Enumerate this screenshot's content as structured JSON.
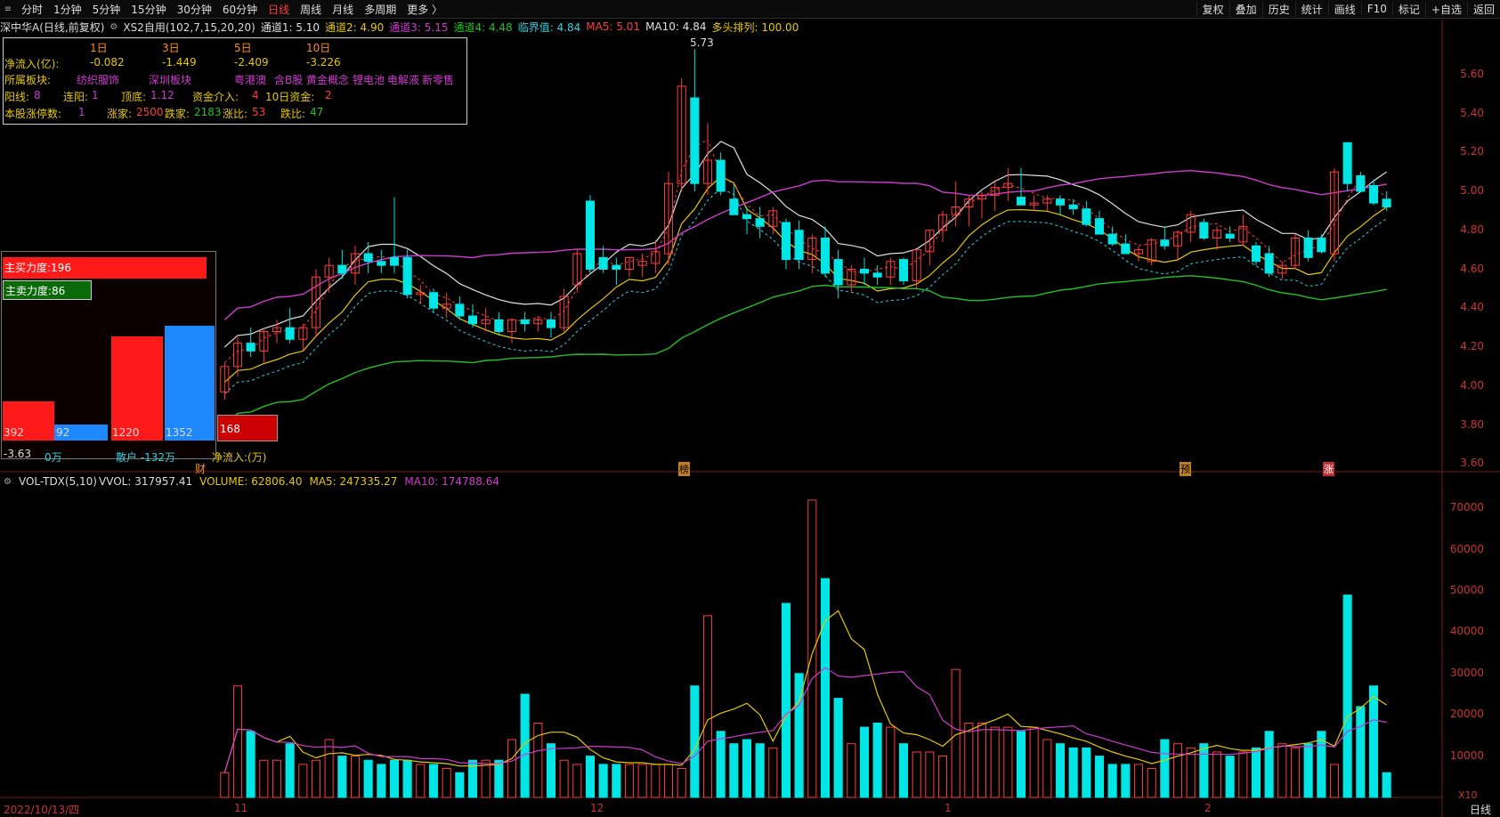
{
  "toolbar": {
    "tabs": [
      "分时",
      "1分钟",
      "5分钟",
      "15分钟",
      "30分钟",
      "60分钟",
      "日线",
      "周线",
      "月线",
      "多周期",
      "更多 〉"
    ],
    "active_tab": "日线",
    "right_buttons": [
      "复权",
      "叠加",
      "历史",
      "统计",
      "画线",
      "F10",
      "标记",
      "+自选",
      "返回"
    ]
  },
  "title": {
    "stock": "深中华A",
    "mode": "(日线,前复权)",
    "indicator": "XS2自用(102,7,15,20,20)",
    "ch1": "通道1: 5.10",
    "ch2": "通道2: 4.90",
    "ch3": "通道3: 5.15",
    "ch4": "通道4: 4.48",
    "critical": "临界值: 4.84",
    "ma5": "MA5: 5.01",
    "ma10": "MA10: 4.84",
    "bull": "多头排列: 100.00"
  },
  "info": {
    "h1d": "1日",
    "h3d": "3日",
    "h5d": "5日",
    "h10d": "10日",
    "net_label": "净流入(亿):",
    "v1d": "-0.082",
    "v3d": "-1.449",
    "v5d": "-2.409",
    "v10d": "-3.226",
    "sector_label": "所属板块:",
    "sectors": [
      "纺织服饰",
      "深圳板块",
      "粤港澳",
      "含B股",
      "黄金概念",
      "锂电池",
      "电解液",
      "新零售"
    ],
    "yang_label": "阳线:",
    "yang": "8",
    "lianyang_label": "连阳:",
    "lianyang": "1",
    "dingdi_label": "顶底:",
    "dingdi": "1.12",
    "zijin_label": "资金介入:",
    "zijin": "4",
    "tenday_label": "10日资金:",
    "tenday": "2",
    "limit_label": "本股涨停数:",
    "limit": "1",
    "up_label": "涨家:",
    "up": "2500",
    "down_label": "跌家:",
    "down": "2183",
    "upr_label": "涨比:",
    "upr": "53",
    "downr_label": "跌比:",
    "downr": "47"
  },
  "force": {
    "buy": "主买力度:196",
    "sell": "主卖力度:86",
    "b1": "392",
    "b2": "92",
    "b3": "1220",
    "b4": "1352",
    "b5": "168",
    "main": "-3.63",
    "main_unit": "0万",
    "retail": "散户 -132万",
    "net": "净流入:(万)"
  },
  "volume_title": {
    "name": "VOL-TDX(5,10)",
    "vvol": "VVOL: 317957.41",
    "volume": "VOLUME: 62806.40",
    "ma5": "MA5: 247335.27",
    "ma10": "MA10: 174788.64"
  },
  "price_axis": [
    "5.60",
    "5.40",
    "5.20",
    "5.00",
    "4.80",
    "4.60",
    "4.40",
    "4.20",
    "4.00",
    "3.80",
    "3.60"
  ],
  "vol_axis": [
    "70000",
    "60000",
    "50000",
    "40000",
    "30000",
    "20000",
    "10000"
  ],
  "x_labels": {
    "start": "2022/10/13/四",
    "m11": "11",
    "m12": "12",
    "m1": "1",
    "m2": "2"
  },
  "markers": {
    "cai": "财",
    "bang": "榜",
    "yu": "预",
    "zhang": "涨"
  },
  "max_price": "5.73",
  "vol_unit": "X10",
  "daily": "日线",
  "colors": {
    "up": "#ff3c3c",
    "down": "#00e5e5",
    "ch_white": "#e0e0e0",
    "ch_yellow": "#e6c800",
    "ch_magenta": "#d03ad0",
    "ch_green": "#22c022",
    "ch_red_dash": "#ff3c3c",
    "ch_cyan_dash": "#2fd0e0"
  },
  "chart_data": {
    "type": "candlestick",
    "candles": [
      [
        3.97,
        4.12,
        3.93,
        4.1
      ],
      [
        4.1,
        4.25,
        4.05,
        4.22
      ],
      [
        4.22,
        4.3,
        4.15,
        4.18
      ],
      [
        4.18,
        4.3,
        4.12,
        4.28
      ],
      [
        4.28,
        4.34,
        4.22,
        4.3
      ],
      [
        4.3,
        4.4,
        4.22,
        4.24
      ],
      [
        4.24,
        4.32,
        4.18,
        4.3
      ],
      [
        4.3,
        4.6,
        4.25,
        4.56
      ],
      [
        4.56,
        4.66,
        4.48,
        4.62
      ],
      [
        4.62,
        4.7,
        4.55,
        4.58
      ],
      [
        4.58,
        4.72,
        4.52,
        4.68
      ],
      [
        4.68,
        4.74,
        4.58,
        4.64
      ],
      [
        4.64,
        4.7,
        4.58,
        4.62
      ],
      [
        4.66,
        4.97,
        4.58,
        4.62
      ],
      [
        4.66,
        4.7,
        4.45,
        4.47
      ],
      [
        4.47,
        4.52,
        4.42,
        4.48
      ],
      [
        4.48,
        4.5,
        4.38,
        4.4
      ],
      [
        4.4,
        4.48,
        4.35,
        4.42
      ],
      [
        4.42,
        4.46,
        4.34,
        4.36
      ],
      [
        4.36,
        4.42,
        4.3,
        4.32
      ],
      [
        4.32,
        4.4,
        4.28,
        4.34
      ],
      [
        4.34,
        4.38,
        4.26,
        4.28
      ],
      [
        4.28,
        4.35,
        4.22,
        4.34
      ],
      [
        4.34,
        4.38,
        4.28,
        4.32
      ],
      [
        4.32,
        4.36,
        4.28,
        4.34
      ],
      [
        4.34,
        4.38,
        4.25,
        4.3
      ],
      [
        4.3,
        4.5,
        4.28,
        4.46
      ],
      [
        4.52,
        4.7,
        4.48,
        4.68
      ],
      [
        4.95,
        4.98,
        4.58,
        4.6
      ],
      [
        4.66,
        4.72,
        4.58,
        4.6
      ],
      [
        4.62,
        4.66,
        4.52,
        4.6
      ],
      [
        4.6,
        4.66,
        4.56,
        4.66
      ],
      [
        4.62,
        4.68,
        4.56,
        4.64
      ],
      [
        4.63,
        4.75,
        4.58,
        4.69
      ],
      [
        4.68,
        5.1,
        4.62,
        5.04
      ],
      [
        5.04,
        5.58,
        5.0,
        5.54
      ],
      [
        5.48,
        5.73,
        5.0,
        5.04
      ],
      [
        5.04,
        5.35,
        4.98,
        5.16
      ],
      [
        5.16,
        5.2,
        4.98,
        5.0
      ],
      [
        4.96,
        5.03,
        4.88,
        4.88
      ],
      [
        4.88,
        4.92,
        4.78,
        4.86
      ],
      [
        4.86,
        4.92,
        4.76,
        4.82
      ],
      [
        4.82,
        4.92,
        4.78,
        4.9
      ],
      [
        4.84,
        4.86,
        4.6,
        4.65
      ],
      [
        4.8,
        4.85,
        4.6,
        4.65
      ],
      [
        4.65,
        4.78,
        4.58,
        4.76
      ],
      [
        4.76,
        4.82,
        4.56,
        4.58
      ],
      [
        4.65,
        4.7,
        4.45,
        4.52
      ],
      [
        4.52,
        4.62,
        4.48,
        4.6
      ],
      [
        4.6,
        4.66,
        4.52,
        4.58
      ],
      [
        4.58,
        4.62,
        4.52,
        4.56
      ],
      [
        4.56,
        4.66,
        4.52,
        4.64
      ],
      [
        4.65,
        4.66,
        4.52,
        4.54
      ],
      [
        4.54,
        4.7,
        4.5,
        4.7
      ],
      [
        4.69,
        4.8,
        4.62,
        4.8
      ],
      [
        4.8,
        4.9,
        4.74,
        4.88
      ],
      [
        4.88,
        5.05,
        4.82,
        4.92
      ],
      [
        4.92,
        4.98,
        4.82,
        4.96
      ],
      [
        4.96,
        5.0,
        4.86,
        4.98
      ],
      [
        4.98,
        5.05,
        4.9,
        5.02
      ],
      [
        5.02,
        5.12,
        4.95,
        5.04
      ],
      [
        4.97,
        5.12,
        4.94,
        4.93
      ],
      [
        4.93,
        4.98,
        4.9,
        4.94
      ],
      [
        4.94,
        4.98,
        4.9,
        4.96
      ],
      [
        4.96,
        4.98,
        4.88,
        4.93
      ],
      [
        4.93,
        4.96,
        4.88,
        4.91
      ],
      [
        4.91,
        4.95,
        4.82,
        4.83
      ],
      [
        4.86,
        4.9,
        4.78,
        4.78
      ],
      [
        4.78,
        4.82,
        4.72,
        4.73
      ],
      [
        4.73,
        4.78,
        4.68,
        4.68
      ],
      [
        4.68,
        4.72,
        4.64,
        4.7
      ],
      [
        4.64,
        4.76,
        4.62,
        4.75
      ],
      [
        4.75,
        4.82,
        4.7,
        4.72
      ],
      [
        4.72,
        4.8,
        4.65,
        4.79
      ],
      [
        4.79,
        4.9,
        4.74,
        4.88
      ],
      [
        4.84,
        4.86,
        4.75,
        4.76
      ],
      [
        4.76,
        4.82,
        4.7,
        4.8
      ],
      [
        4.78,
        4.82,
        4.74,
        4.76
      ],
      [
        4.74,
        4.88,
        4.72,
        4.82
      ],
      [
        4.72,
        4.74,
        4.62,
        4.64
      ],
      [
        4.68,
        4.72,
        4.56,
        4.58
      ],
      [
        4.58,
        4.64,
        4.55,
        4.62
      ],
      [
        4.62,
        4.78,
        4.6,
        4.76
      ],
      [
        4.76,
        4.8,
        4.64,
        4.66
      ],
      [
        4.76,
        4.78,
        4.68,
        4.69
      ],
      [
        4.68,
        5.12,
        4.64,
        5.1
      ],
      [
        5.25,
        5.25,
        5.0,
        5.04
      ],
      [
        5.08,
        5.1,
        5.0,
        5.0
      ],
      [
        5.03,
        5.06,
        4.93,
        4.94
      ],
      [
        4.96,
        5.0,
        4.9,
        4.92
      ]
    ],
    "volume": [
      6,
      27,
      16,
      9,
      9,
      13,
      8,
      9,
      14,
      10,
      10,
      9,
      8,
      9,
      9,
      8,
      8,
      7,
      6,
      9,
      9,
      9,
      14,
      25,
      18,
      13,
      9,
      8,
      10,
      8,
      8,
      8,
      8,
      8,
      8,
      7,
      27,
      44,
      16,
      13,
      14,
      13,
      12,
      47,
      30,
      72,
      53,
      24,
      13,
      17,
      18,
      17,
      13,
      11,
      11,
      10,
      31,
      18,
      18,
      17,
      17,
      16,
      17,
      14,
      13,
      12,
      12,
      10,
      8,
      8,
      8,
      7,
      14,
      13,
      12,
      13,
      11,
      10,
      11,
      12,
      16,
      13,
      12,
      13,
      16,
      8,
      49,
      22,
      27,
      6
    ],
    "price_range": [
      3.56,
      5.8
    ],
    "volume_range": [
      0,
      75000
    ]
  }
}
